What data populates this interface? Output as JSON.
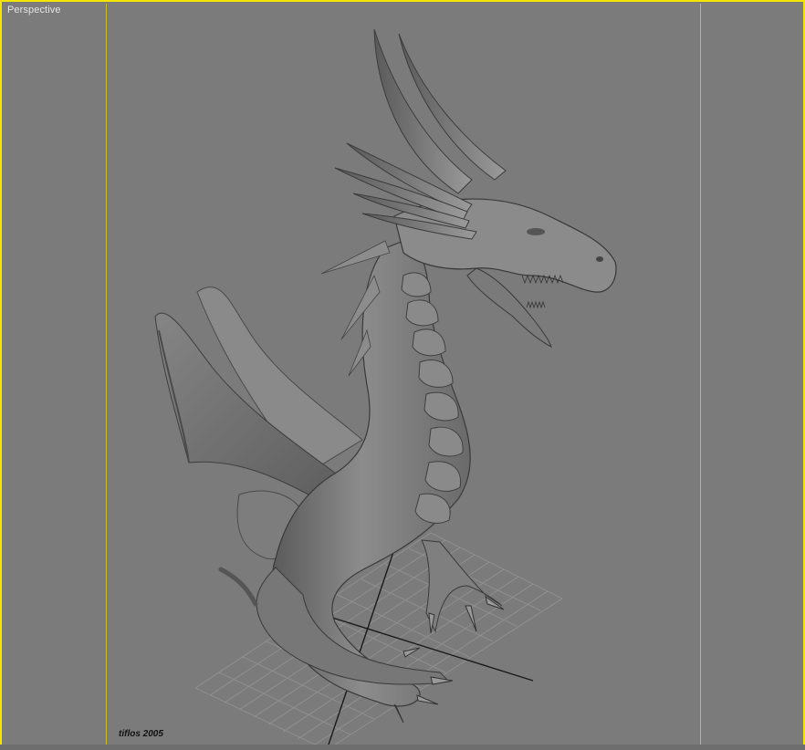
{
  "viewport": {
    "label": "Perspective",
    "border_color": "#f5e600",
    "background_color": "#7b7b7b"
  },
  "scene": {
    "subject_icon": "dragon-model",
    "ground": "grid-plane"
  },
  "signature": {
    "text": "tiflos 2005"
  }
}
